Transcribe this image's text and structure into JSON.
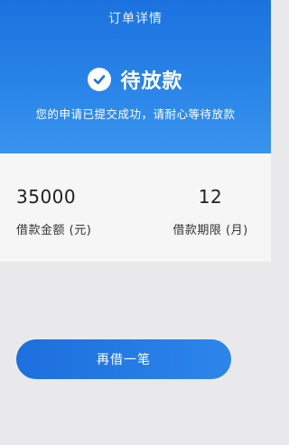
{
  "header": {
    "title": "订单详情"
  },
  "status": {
    "title": "待放款",
    "description": "您的申请已提交成功，请耐心等待放款",
    "icon": "check-circle-icon"
  },
  "loan_info": {
    "amount_value": "35000",
    "amount_label": "借款金额 (元)",
    "term_value": "12",
    "term_label": "借款期限 (月)"
  },
  "actions": {
    "borrow_again_label": "再借一笔"
  },
  "colors": {
    "primary": "#1b72df",
    "background": "#e9e9eb",
    "card": "#f6f6f7"
  }
}
